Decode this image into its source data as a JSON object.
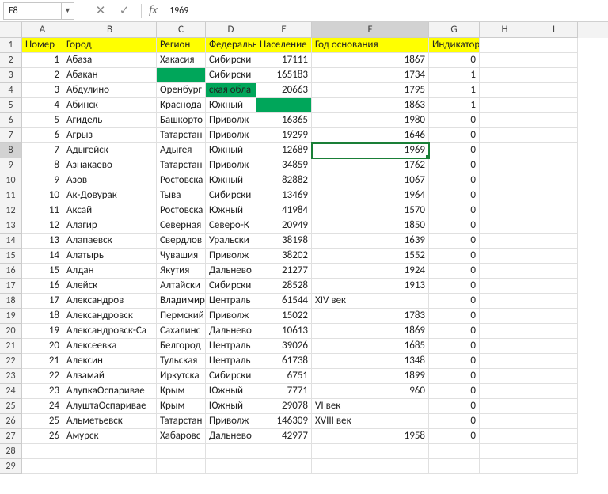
{
  "namebox": {
    "ref": "F8",
    "value": "1969",
    "fx": "fx"
  },
  "columns": [
    {
      "letter": "A",
      "w": 52
    },
    {
      "letter": "B",
      "w": 118
    },
    {
      "letter": "C",
      "w": 62
    },
    {
      "letter": "D",
      "w": 64
    },
    {
      "letter": "E",
      "w": 70
    },
    {
      "letter": "F",
      "w": 148
    },
    {
      "letter": "G",
      "w": 64
    },
    {
      "letter": "H",
      "w": 64
    },
    {
      "letter": "I",
      "w": 60
    }
  ],
  "headers": [
    "Номер",
    "Город",
    "Регион",
    "Федеральн",
    "Население",
    "Год основания",
    "Индикатор",
    "",
    ""
  ],
  "rows": [
    {
      "r": 2,
      "n": 1,
      "city": "Абаза",
      "reg": "Хакасия",
      "fed": "Сибирски",
      "pop": "17111",
      "year": "1867",
      "ind": "0",
      "gC": false,
      "gE": false
    },
    {
      "r": 3,
      "n": 2,
      "city": "Абакан",
      "reg": "",
      "fed": "Сибирски",
      "pop": "165183",
      "year": "1734",
      "ind": "1",
      "gC": true,
      "gE": false
    },
    {
      "r": 4,
      "n": 3,
      "city": "Абдулино",
      "reg": "Оренбург",
      "fed": "ская обла",
      "pop": "20663",
      "year": "1795",
      "ind": "1",
      "gC": false,
      "gD": true,
      "gE": false
    },
    {
      "r": 5,
      "n": 4,
      "city": "Абинск",
      "reg": "Краснода",
      "fed": "Южный",
      "pop": "",
      "year": "1863",
      "ind": "1",
      "gC": false,
      "gE": true
    },
    {
      "r": 6,
      "n": 5,
      "city": "Агидель",
      "reg": "Башкорто",
      "fed": "Приволж",
      "pop": "16365",
      "year": "1980",
      "ind": "0",
      "gC": false,
      "gE": false
    },
    {
      "r": 7,
      "n": 6,
      "city": "Агрыз",
      "reg": "Татарстан",
      "fed": "Приволж",
      "pop": "19299",
      "year": "1646",
      "ind": "0",
      "gC": false,
      "gE": false
    },
    {
      "r": 8,
      "n": 7,
      "city": "Адыгейск",
      "reg": "Адыгея",
      "fed": "Южный",
      "pop": "12689",
      "year": "1969",
      "ind": "0",
      "gC": false,
      "gE": false,
      "active": true
    },
    {
      "r": 9,
      "n": 8,
      "city": "Азнакаево",
      "reg": "Татарстан",
      "fed": "Приволж",
      "pop": "34859",
      "year": "1762",
      "ind": "0",
      "gC": false,
      "gE": false
    },
    {
      "r": 10,
      "n": 9,
      "city": "Азов",
      "reg": "Ростовска",
      "fed": "Южный",
      "pop": "82882",
      "year": "1067",
      "ind": "0",
      "gC": false,
      "gE": false
    },
    {
      "r": 11,
      "n": 10,
      "city": "Ак-Довурак",
      "reg": "Тыва",
      "fed": "Сибирски",
      "pop": "13469",
      "year": "1964",
      "ind": "0",
      "gC": false,
      "gE": false
    },
    {
      "r": 12,
      "n": 11,
      "city": "Аксай",
      "reg": "Ростовска",
      "fed": "Южный",
      "pop": "41984",
      "year": "1570",
      "ind": "0",
      "gC": false,
      "gE": false
    },
    {
      "r": 13,
      "n": 12,
      "city": "Алагир",
      "reg": "Северная",
      "fed": "Северо-К",
      "pop": "20949",
      "year": "1850",
      "ind": "0",
      "gC": false,
      "gE": false
    },
    {
      "r": 14,
      "n": 13,
      "city": "Алапаевск",
      "reg": "Свердлов",
      "fed": "Уральски",
      "pop": "38198",
      "year": "1639",
      "ind": "0",
      "gC": false,
      "gE": false
    },
    {
      "r": 15,
      "n": 14,
      "city": "Алатырь",
      "reg": "Чувашия",
      "fed": "Приволж",
      "pop": "38202",
      "year": "1552",
      "ind": "0",
      "gC": false,
      "gE": false
    },
    {
      "r": 16,
      "n": 15,
      "city": "Алдан",
      "reg": "Якутия",
      "fed": "Дальнево",
      "pop": "21277",
      "year": "1924",
      "ind": "0",
      "gC": false,
      "gE": false
    },
    {
      "r": 17,
      "n": 16,
      "city": "Алейск",
      "reg": "Алтайски",
      "fed": "Сибирски",
      "pop": "28528",
      "year": "1913",
      "ind": "0",
      "gC": false,
      "gE": false
    },
    {
      "r": 18,
      "n": 17,
      "city": "Александров",
      "reg": "Владимир",
      "fed": "Централь",
      "pop": "61544",
      "year": "XIV век",
      "ind": "0",
      "gC": false,
      "gE": false,
      "yearLeft": true
    },
    {
      "r": 19,
      "n": 18,
      "city": "Александровск",
      "reg": "Пермский",
      "fed": "Приволж",
      "pop": "15022",
      "year": "1783",
      "ind": "0",
      "gC": false,
      "gE": false
    },
    {
      "r": 20,
      "n": 19,
      "city": "Александровск-Са",
      "reg": "Сахалинс",
      "fed": "Дальнево",
      "pop": "10613",
      "year": "1869",
      "ind": "0",
      "gC": false,
      "gE": false
    },
    {
      "r": 21,
      "n": 20,
      "city": "Алексеевка",
      "reg": "Белгород",
      "fed": "Централь",
      "pop": "39026",
      "year": "1685",
      "ind": "0",
      "gC": false,
      "gE": false
    },
    {
      "r": 22,
      "n": 21,
      "city": "Алексин",
      "reg": "Тульская",
      "fed": "Централь",
      "pop": "61738",
      "year": "1348",
      "ind": "0",
      "gC": false,
      "gE": false
    },
    {
      "r": 23,
      "n": 22,
      "city": "Алзамай",
      "reg": "Иркутска",
      "fed": "Сибирски",
      "pop": "6751",
      "year": "1899",
      "ind": "0",
      "gC": false,
      "gE": false
    },
    {
      "r": 24,
      "n": 23,
      "city": "АлупкаОспаривае",
      "reg": "Крым",
      "fed": "Южный",
      "pop": "7771",
      "year": "960",
      "ind": "0",
      "gC": false,
      "gE": false
    },
    {
      "r": 25,
      "n": 24,
      "city": "АлуштаОспаривае",
      "reg": "Крым",
      "fed": "Южный",
      "pop": "29078",
      "year": "VI век",
      "ind": "0",
      "gC": false,
      "gE": false,
      "yearLeft": true
    },
    {
      "r": 26,
      "n": 25,
      "city": "Альметьевск",
      "reg": "Татарстан",
      "fed": "Приволж",
      "pop": "146309",
      "year": "XVIII век",
      "ind": "0",
      "gC": false,
      "gE": false,
      "yearLeft": true
    },
    {
      "r": 27,
      "n": 26,
      "city": "Амурск",
      "reg": "Хабаровс",
      "fed": "Дальнево",
      "pop": "42977",
      "year": "1958",
      "ind": "0",
      "gC": false,
      "gE": false
    }
  ],
  "blankRows": [
    28,
    29
  ]
}
